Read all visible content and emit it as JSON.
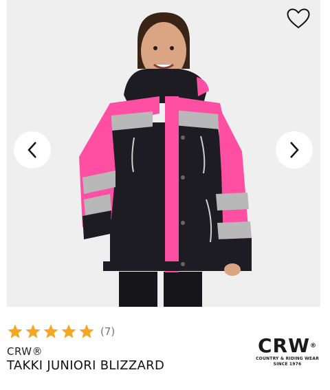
{
  "product": {
    "brand": "CRW®",
    "title": "TAKKI JUNIORI BLIZZARD",
    "rating": {
      "stars": 5,
      "max": 5,
      "count_label": "(7)"
    }
  },
  "logo": {
    "main": "CRW",
    "reg": "®",
    "line1": "COUNTRY & RIDING WEAR",
    "line2": "SINCE 1976"
  },
  "icons": {
    "favorite": "heart-outline-icon",
    "prev": "chevron-left-icon",
    "next": "chevron-right-icon",
    "star": "star-filled-icon"
  },
  "colors": {
    "star": "#f5a623",
    "jacket_pink": "#ff4fa3",
    "jacket_black": "#1c1c22",
    "reflective": "#b8b8b8",
    "background": "#efefef"
  }
}
